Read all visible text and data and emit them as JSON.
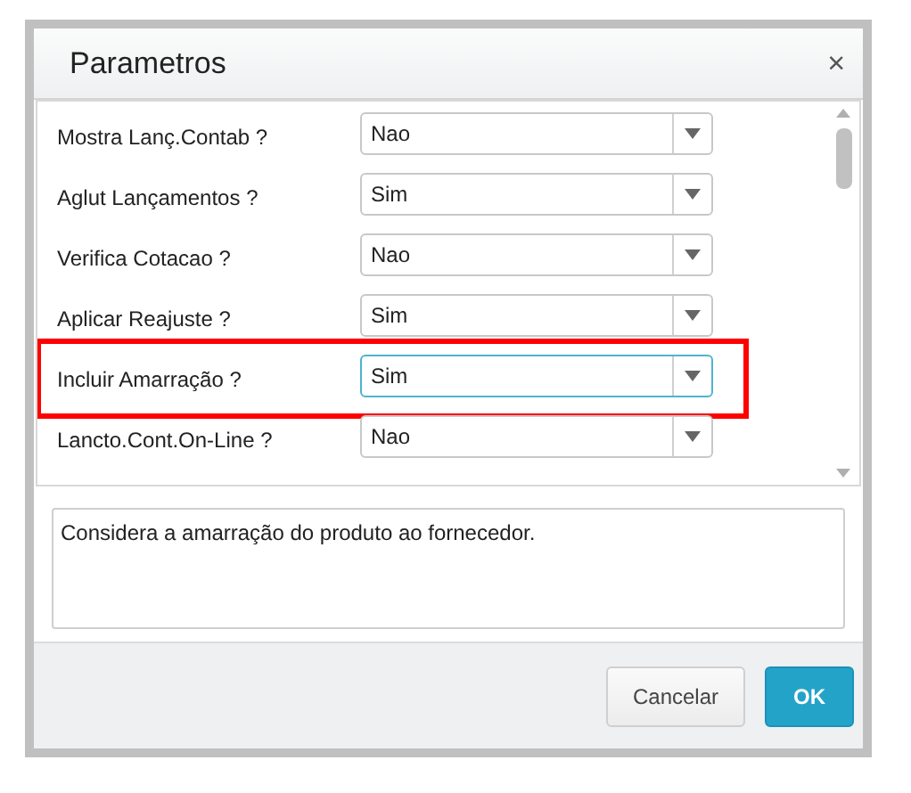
{
  "dialog": {
    "title": "Parametros",
    "close": "×"
  },
  "parameters": [
    {
      "label": "Mostra Lanç.Contab ?",
      "value": "Nao",
      "focused": false,
      "highlighted": false
    },
    {
      "label": "Aglut Lançamentos ?",
      "value": "Sim",
      "focused": false,
      "highlighted": false
    },
    {
      "label": "Verifica Cotacao ?",
      "value": "Nao",
      "focused": false,
      "highlighted": false
    },
    {
      "label": "Aplicar Reajuste ?",
      "value": "Sim",
      "focused": false,
      "highlighted": false
    },
    {
      "label": "Incluir Amarração ?",
      "value": "Sim",
      "focused": true,
      "highlighted": true
    },
    {
      "label": "Lancto.Cont.On-Line ?",
      "value": "Nao",
      "focused": false,
      "highlighted": false
    }
  ],
  "description": "Considera a amarração do produto ao fornecedor.",
  "buttons": [
    {
      "label": "Cancelar",
      "kind": "secondary"
    },
    {
      "label": "OK",
      "kind": "primary"
    }
  ]
}
